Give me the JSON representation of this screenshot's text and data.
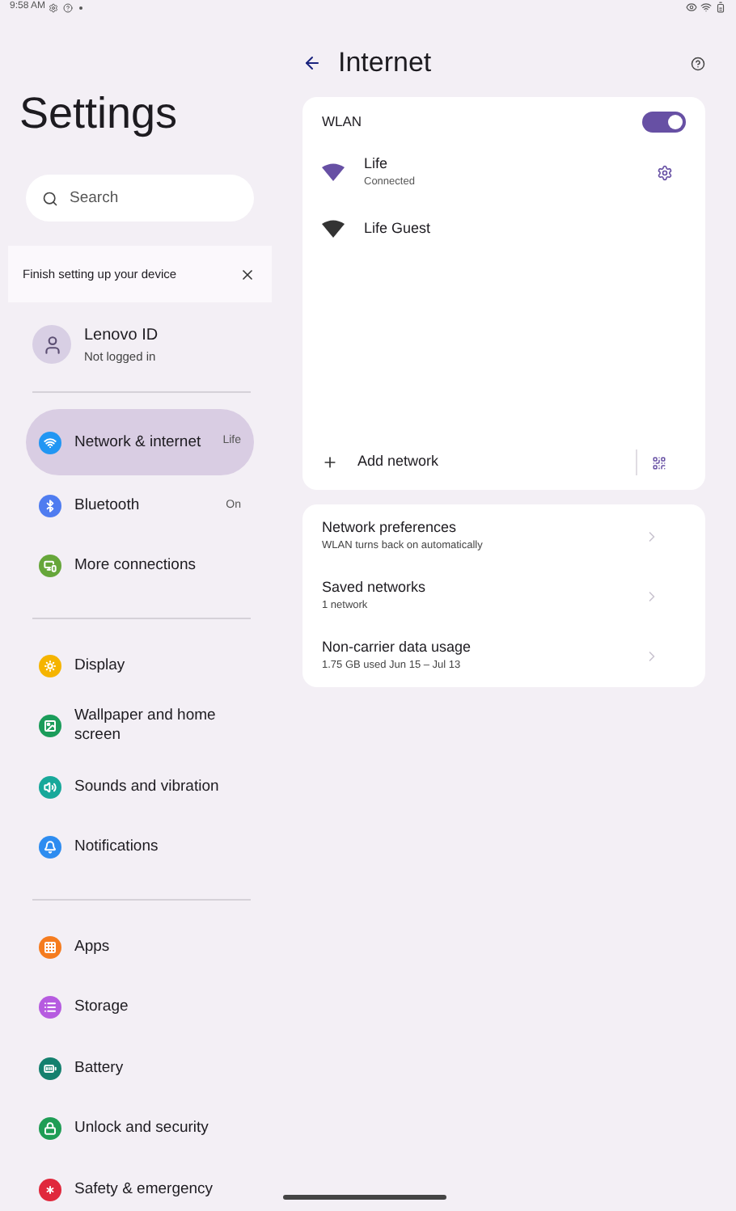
{
  "status_bar": {
    "time": "9:58 AM"
  },
  "sidebar": {
    "title": "Settings",
    "search": {
      "placeholder": "Search"
    },
    "banner": {
      "text": "Finish setting up your device"
    },
    "account": {
      "name": "Lenovo ID",
      "status": "Not logged in"
    },
    "groups": [
      {
        "items": [
          {
            "label": "Network & internet",
            "value": "Life",
            "selected": true,
            "color": "#2196f3"
          },
          {
            "label": "Bluetooth",
            "value": "On",
            "selected": false,
            "color": "#4f7cf0"
          },
          {
            "label": "More connections",
            "selected": false,
            "color": "#66a63a"
          }
        ]
      },
      {
        "items": [
          {
            "label": "Display",
            "selected": false,
            "color": "#f5b400"
          },
          {
            "label": "Wallpaper and home screen",
            "selected": false,
            "color": "#1b9c5a"
          },
          {
            "label": "Sounds and vibration",
            "selected": false,
            "color": "#17a89a"
          },
          {
            "label": "Notifications",
            "selected": false,
            "color": "#2d8cf0"
          }
        ]
      },
      {
        "items": [
          {
            "label": "Apps",
            "selected": false,
            "color": "#f57c1f"
          },
          {
            "label": "Storage",
            "selected": false,
            "color": "#b65be0"
          },
          {
            "label": "Battery",
            "selected": false,
            "color": "#14806e"
          },
          {
            "label": "Unlock and security",
            "selected": false,
            "color": "#1f9d55"
          },
          {
            "label": "Safety & emergency",
            "selected": false,
            "color": "#e0283c"
          }
        ]
      }
    ]
  },
  "page": {
    "title": "Internet",
    "wlan": {
      "label": "WLAN",
      "on": true
    },
    "networks": [
      {
        "name": "Life",
        "status": "Connected",
        "selected": true
      },
      {
        "name": "Life Guest",
        "selected": false
      }
    ],
    "add_network": "Add network",
    "options": [
      {
        "title": "Network preferences",
        "subtitle": "WLAN turns back on automatically"
      },
      {
        "title": "Saved networks",
        "subtitle": "1 network"
      },
      {
        "title": "Non-carrier data usage",
        "subtitle": "1.75 GB used Jun 15 – Jul 13"
      }
    ]
  }
}
